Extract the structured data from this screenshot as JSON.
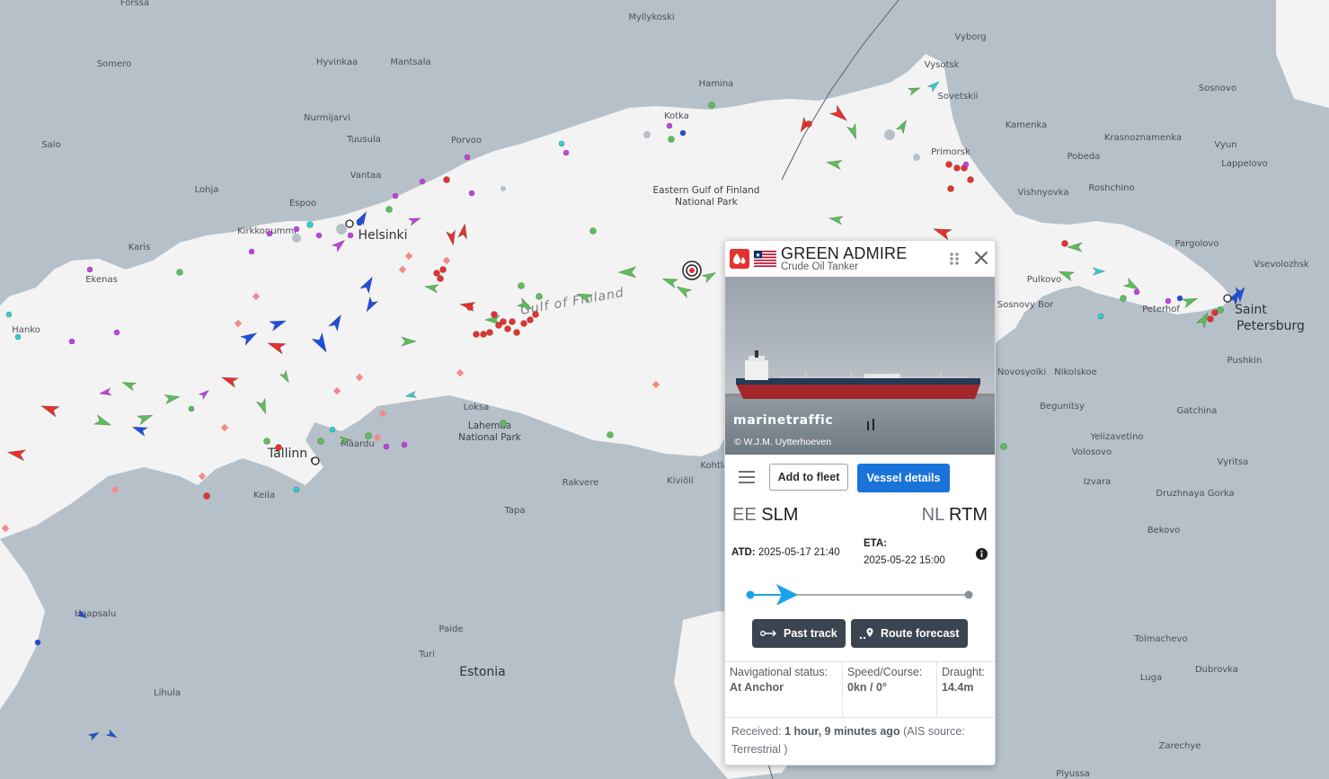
{
  "map": {
    "water_labels": [
      "Gulf of Finland"
    ],
    "park_labels": [
      {
        "lines": [
          "Eastern Gulf of Finland",
          "National Park"
        ]
      },
      {
        "lines": [
          "Lahemaa",
          "National Park"
        ]
      }
    ],
    "big_labels": [
      "Helsinki",
      "Tallinn",
      "Estonia",
      "Saint",
      "Petersburg"
    ],
    "place_labels": [
      "Forssa",
      "Myllykoski",
      "Vyborg",
      "Somero",
      "Hyvinkaa",
      "Mantsala",
      "Vysotsk",
      "Hamina",
      "Sosnovo",
      "Sovetskii",
      "Nurmijarvi",
      "Kotka",
      "Kamenka",
      "Salo",
      "Tuusula",
      "Porvoo",
      "Krasnoznamenka",
      "Vyun",
      "Primorsk",
      "Pobeda",
      "Lappelovo",
      "Vantaa",
      "Lohja",
      "Vishnyovka",
      "Roshchino",
      "Espoo",
      "Kirkkonummi",
      "Karis",
      "Pargolovo",
      "Vsevolozhsk",
      "Ekenas",
      "Pulkovo",
      "Sosnovy Bor",
      "Peterhof",
      "Hanko",
      "Pushkin",
      "Novosyolki",
      "Nikolskoe",
      "Loksa",
      "Begunitsy",
      "Gatchina",
      "Maardu",
      "Yelizavetino",
      "Volosovo",
      "Kohtla",
      "Keila",
      "Rakvere",
      "Kiviõli",
      "Izvara",
      "Vyritsa",
      "Druzhnaya Gorka",
      "Tapa",
      "Bekovo",
      "Haapsalu",
      "Paide",
      "Tolmachevo",
      "Turi",
      "Dubrovka",
      "Luga",
      "Lihula",
      "Zarechye",
      "Plyussa"
    ]
  },
  "popup": {
    "vessel_name": "GREEN ADMIRE",
    "vessel_type": "Crude Oil Tanker",
    "type_icon": "droplet-icon",
    "flag": "liberia-flag",
    "photo_brand": "marinetraffic",
    "photo_credit": "© W.J.M. Uytterhoeven",
    "add_to_fleet": "Add to fleet",
    "vessel_details": "Vessel details",
    "departure_country": "EE",
    "departure_port": "SLM",
    "arrival_country": "NL",
    "arrival_port": "RTM",
    "atd_label": "ATD:",
    "atd_value": "2025-05-17 21:40",
    "eta_label": "ETA:",
    "eta_value": "2025-05-22 15:00",
    "progress": 0.16,
    "past_track": "Past track",
    "route_forecast": "Route forecast",
    "nav_status_label": "Navigational status:",
    "nav_status_value": "At Anchor",
    "speed_label": "Speed/Course:",
    "speed_value": "0kn / 0°",
    "draught_label": "Draught:",
    "draught_value": "14.4m",
    "received_label": "Received:",
    "received_value": "1 hour, 9 minutes ago",
    "received_source": "(AIS source: Terrestrial )"
  },
  "colors": {
    "land": "#b6c0c9",
    "sea": "#f3f3f3",
    "tanker": "#e5322f",
    "cargo": "#5cbf5a",
    "passenger": "#1f4fe0",
    "pleasure": "#c540e6",
    "tug": "#2fd0d0",
    "primary_button": "#1a73d9",
    "dark_button": "#3b4451"
  }
}
